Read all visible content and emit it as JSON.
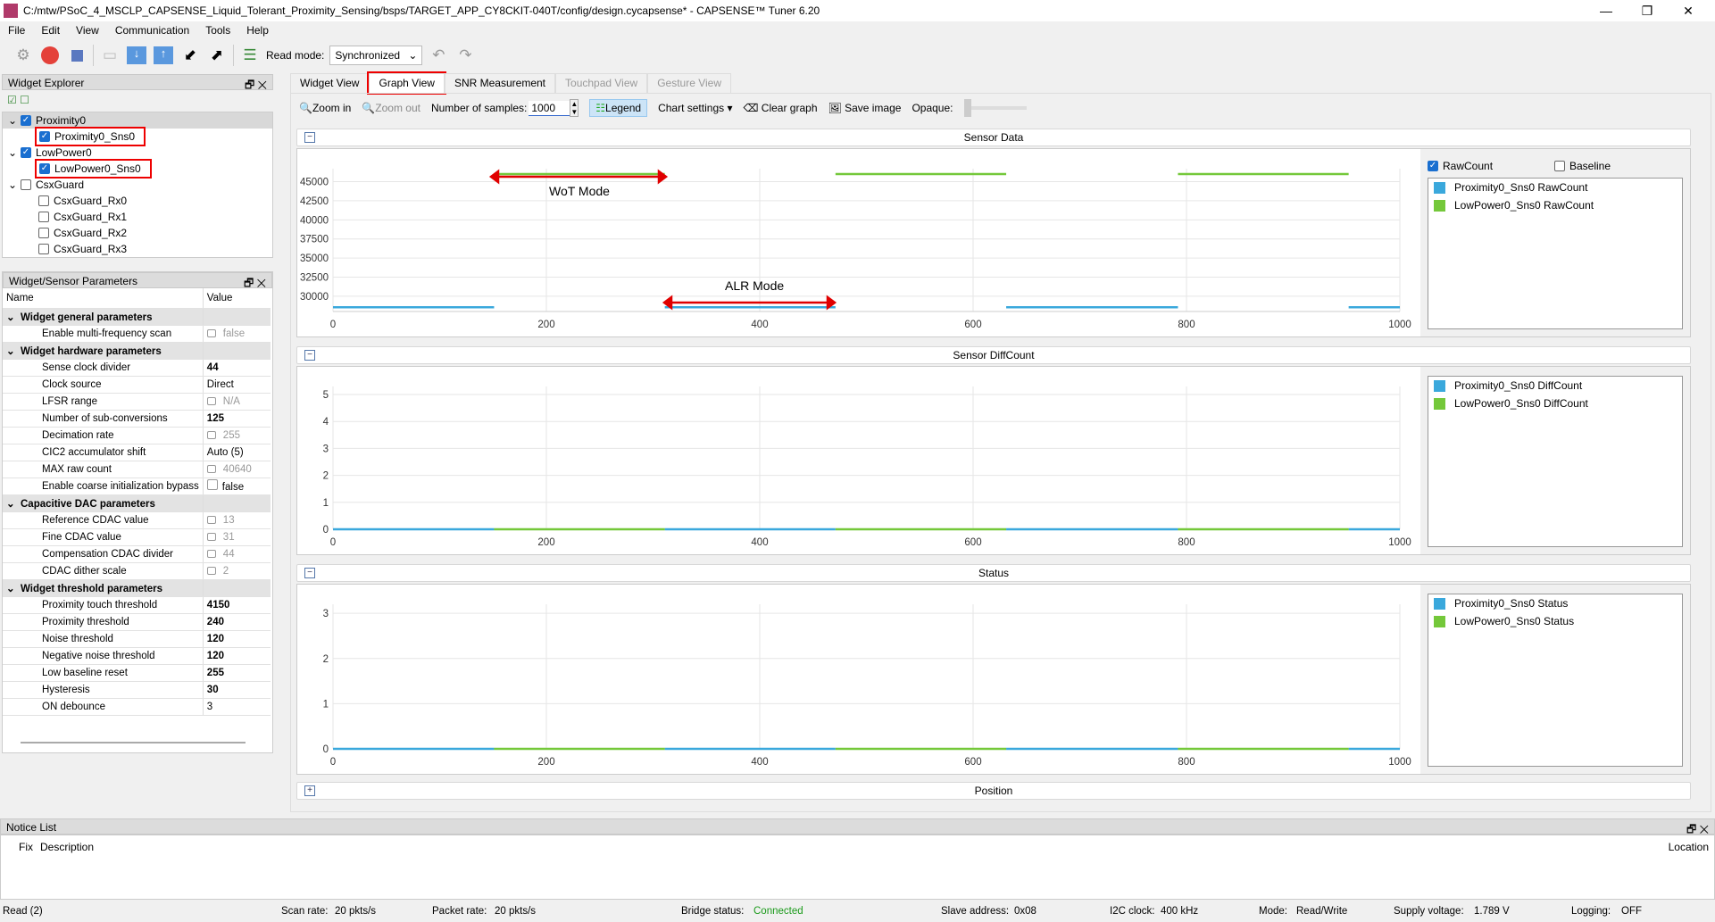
{
  "window": {
    "title": "C:/mtw/PSoC_4_MSCLP_CAPSENSE_Liquid_Tolerant_Proximity_Sensing/bsps/TARGET_APP_CY8CKIT-040T/config/design.cycapsense* - CAPSENSE™ Tuner 6.20",
    "minimize": "—",
    "maximize": "❐",
    "close": "✕"
  },
  "menu": [
    "File",
    "Edit",
    "View",
    "Communication",
    "Tools",
    "Help"
  ],
  "toolbar": {
    "read_mode_label": "Read mode:",
    "read_mode_value": "Synchronized",
    "icons": [
      "gear-icon",
      "disconnect-icon",
      "stop-icon",
      "open-icon",
      "read-icon",
      "write-icon",
      "import-icon",
      "export-icon",
      "log-icon",
      "undo-icon",
      "redo-icon"
    ]
  },
  "widget_explorer": {
    "title": "Widget Explorer",
    "tree": [
      {
        "label": "Proximity0",
        "checked": true,
        "level": 0
      },
      {
        "label": "Proximity0_Sns0",
        "checked": true,
        "level": 1,
        "highlight": true
      },
      {
        "label": "LowPower0",
        "checked": true,
        "level": 0
      },
      {
        "label": "LowPower0_Sns0",
        "checked": true,
        "level": 1,
        "highlight": true
      },
      {
        "label": "CsxGuard",
        "checked": false,
        "level": 0
      },
      {
        "label": "CsxGuard_Rx0",
        "checked": false,
        "level": 1
      },
      {
        "label": "CsxGuard_Rx1",
        "checked": false,
        "level": 1
      },
      {
        "label": "CsxGuard_Rx2",
        "checked": false,
        "level": 1
      },
      {
        "label": "CsxGuard_Rx3",
        "checked": false,
        "level": 1
      }
    ]
  },
  "params": {
    "title": "Widget/Sensor Parameters",
    "col_name": "Name",
    "col_value": "Value",
    "rows": [
      {
        "group": "Widget general parameters"
      },
      {
        "name": "Enable multi-frequency scan",
        "value": "false",
        "locked": true
      },
      {
        "group": "Widget hardware parameters"
      },
      {
        "name": "Sense clock divider",
        "value": "44",
        "bold": true
      },
      {
        "name": "Clock source",
        "value": "Direct"
      },
      {
        "name": "LFSR range",
        "value": "N/A",
        "locked": true
      },
      {
        "name": "Number of sub-conversions",
        "value": "125",
        "bold": true
      },
      {
        "name": "Decimation rate",
        "value": "255",
        "locked": true
      },
      {
        "name": "CIC2 accumulator shift",
        "value": "Auto (5)"
      },
      {
        "name": "MAX raw count",
        "value": "40640",
        "locked": true
      },
      {
        "name": "Enable coarse initialization bypass",
        "value": "false",
        "checkbox": true
      },
      {
        "group": "Capacitive DAC parameters"
      },
      {
        "name": "Reference CDAC value",
        "value": "13",
        "locked": true
      },
      {
        "name": "Fine CDAC value",
        "value": "31",
        "locked": true
      },
      {
        "name": "Compensation CDAC divider",
        "value": "44",
        "locked": true
      },
      {
        "name": "CDAC dither scale",
        "value": "2",
        "locked": true
      },
      {
        "group": "Widget threshold parameters"
      },
      {
        "name": "Proximity touch threshold",
        "value": "4150",
        "bold": true
      },
      {
        "name": "Proximity threshold",
        "value": "240",
        "bold": true
      },
      {
        "name": "Noise threshold",
        "value": "120",
        "bold": true
      },
      {
        "name": "Negative noise threshold",
        "value": "120",
        "bold": true
      },
      {
        "name": "Low baseline reset",
        "value": "255",
        "bold": true
      },
      {
        "name": "Hysteresis",
        "value": "30",
        "bold": true
      },
      {
        "name": "ON debounce",
        "value": "3"
      }
    ]
  },
  "tabs": [
    {
      "label": "Widget View"
    },
    {
      "label": "Graph View",
      "active": true
    },
    {
      "label": "SNR Measurement"
    },
    {
      "label": "Touchpad View",
      "disabled": true
    },
    {
      "label": "Gesture View",
      "disabled": true
    }
  ],
  "graph_toolbar": {
    "zoom_in": "Zoom in",
    "zoom_out": "Zoom out",
    "samples_label": "Number of samples:",
    "samples_value": "1000",
    "legend": "Legend",
    "chart_settings": "Chart settings",
    "clear_graph": "Clear graph",
    "save_image": "Save image",
    "opaque": "Opaque:"
  },
  "sections": {
    "sensor_data": "Sensor Data",
    "diffcount": "Sensor DiffCount",
    "status": "Status",
    "position": "Position"
  },
  "rawcount_checkbox": {
    "label": "RawCount",
    "checked": true
  },
  "baseline_checkbox": {
    "label": "Baseline",
    "checked": false
  },
  "annotations": {
    "wot": "WoT Mode",
    "alr": "ALR Mode"
  },
  "colors": {
    "proximity": "#3aa8dc",
    "lowpower": "#74c83a",
    "annotation": "#e00000"
  },
  "chart_data": [
    {
      "type": "line",
      "title": "Sensor Data",
      "xlim": [
        0,
        1000
      ],
      "ylim": [
        28000,
        46700
      ],
      "xticks": [
        0,
        200,
        400,
        600,
        800,
        1000
      ],
      "yticks": [
        30000,
        32500,
        35000,
        37500,
        40000,
        42500,
        45000
      ],
      "grid": true,
      "legend": "right",
      "series": [
        {
          "name": "Proximity0_Sns0 RawCount",
          "color": "#3aa8dc",
          "segments": [
            [
              0,
              151,
              28550
            ],
            [
              311,
              471,
              28550
            ],
            [
              631,
              792,
              28550
            ],
            [
              952,
              1000,
              28550
            ]
          ]
        },
        {
          "name": "LowPower0_Sns0 RawCount",
          "color": "#74c83a",
          "segments": [
            [
              151,
              311,
              46000
            ],
            [
              471,
              631,
              46000
            ],
            [
              792,
              952,
              46000
            ]
          ]
        }
      ]
    },
    {
      "type": "line",
      "title": "Sensor DiffCount",
      "xlim": [
        0,
        1000
      ],
      "ylim": [
        0,
        5.3
      ],
      "xticks": [
        0,
        200,
        400,
        600,
        800,
        1000
      ],
      "yticks": [
        0,
        1,
        2,
        3,
        4,
        5
      ],
      "grid": true,
      "legend": "right",
      "series": [
        {
          "name": "Proximity0_Sns0 DiffCount",
          "color": "#3aa8dc",
          "segments": [
            [
              0,
              151,
              0
            ],
            [
              311,
              471,
              0
            ],
            [
              631,
              792,
              0
            ],
            [
              952,
              1000,
              0
            ]
          ]
        },
        {
          "name": "LowPower0_Sns0 DiffCount",
          "color": "#74c83a",
          "segments": [
            [
              151,
              311,
              0
            ],
            [
              471,
              631,
              0
            ],
            [
              792,
              952,
              0
            ]
          ]
        }
      ]
    },
    {
      "type": "line",
      "title": "Status",
      "xlim": [
        0,
        1000
      ],
      "ylim": [
        0,
        3.2
      ],
      "xticks": [
        0,
        200,
        400,
        600,
        800,
        1000
      ],
      "yticks": [
        0,
        1,
        2,
        3
      ],
      "grid": true,
      "legend": "right",
      "series": [
        {
          "name": "Proximity0_Sns0 Status",
          "color": "#3aa8dc",
          "segments": [
            [
              0,
              151,
              0
            ],
            [
              311,
              471,
              0
            ],
            [
              631,
              792,
              0
            ],
            [
              952,
              1000,
              0
            ]
          ]
        },
        {
          "name": "LowPower0_Sns0 Status",
          "color": "#74c83a",
          "segments": [
            [
              151,
              311,
              0
            ],
            [
              471,
              631,
              0
            ],
            [
              792,
              952,
              0
            ]
          ]
        }
      ]
    }
  ],
  "notice": {
    "title": "Notice List",
    "fix": "Fix",
    "description": "Description",
    "location": "Location"
  },
  "status": {
    "read": "Read (2)",
    "scan_rate_label": "Scan rate:",
    "scan_rate": "20 pkts/s",
    "packet_rate_label": "Packet rate:",
    "packet_rate": "20 pkts/s",
    "bridge_label": "Bridge status:",
    "bridge": "Connected",
    "slave_label": "Slave address:",
    "slave": "0x08",
    "i2c_label": "I2C clock:",
    "i2c": "400 kHz",
    "mode_label": "Mode:",
    "mode": "Read/Write",
    "supply_label": "Supply voltage:",
    "supply": "1.789 V",
    "logging_label": "Logging:",
    "logging": "OFF"
  }
}
